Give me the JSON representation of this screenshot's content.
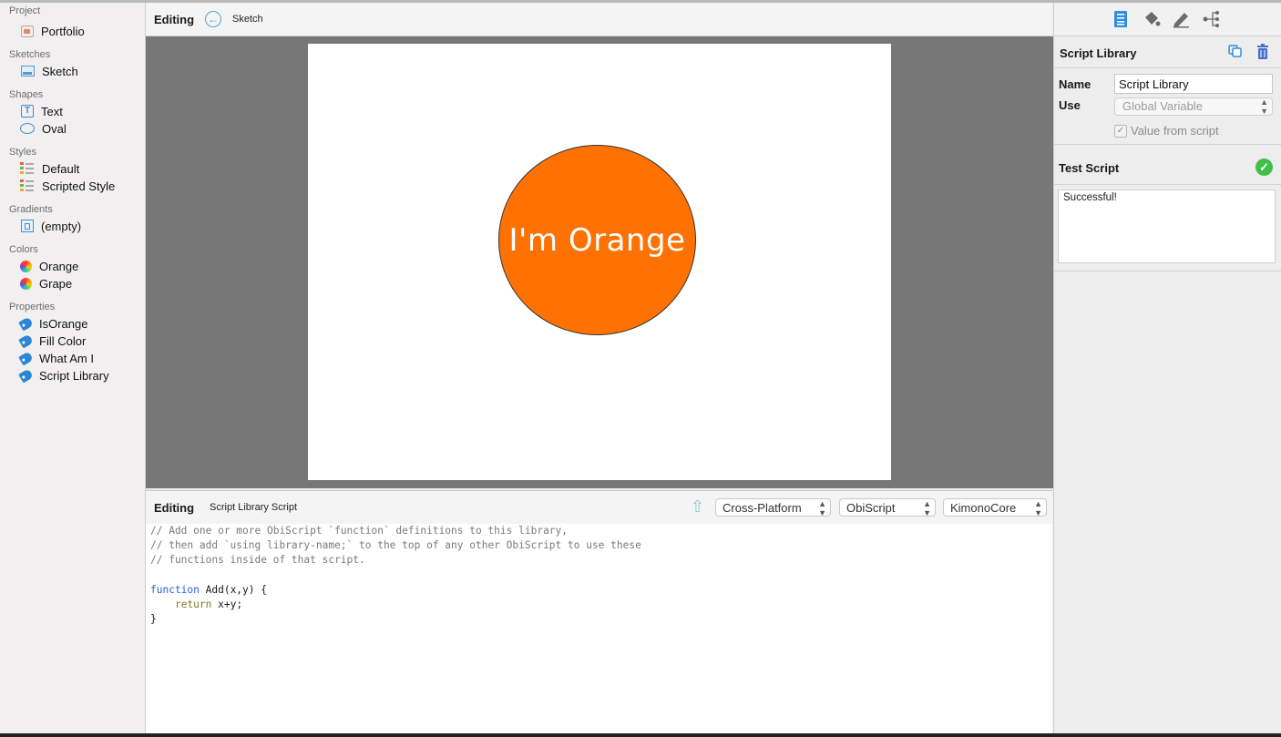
{
  "sidebar": {
    "sections": [
      {
        "title": "Project",
        "items": [
          {
            "label": "Portfolio",
            "icon": "portfolio-icon"
          }
        ]
      },
      {
        "title": "Sketches",
        "items": [
          {
            "label": "Sketch",
            "icon": "sketch-icon"
          }
        ]
      },
      {
        "title": "Shapes",
        "items": [
          {
            "label": "Text",
            "icon": "text-shape-icon"
          },
          {
            "label": "Oval",
            "icon": "oval-shape-icon"
          }
        ]
      },
      {
        "title": "Styles",
        "items": [
          {
            "label": "Default",
            "icon": "style-icon"
          },
          {
            "label": "Scripted Style",
            "icon": "style-icon"
          }
        ]
      },
      {
        "title": "Gradients",
        "items": [
          {
            "label": "(empty)",
            "icon": "gradient-icon"
          }
        ]
      },
      {
        "title": "Colors",
        "items": [
          {
            "label": "Orange",
            "icon": "color-wheel-icon"
          },
          {
            "label": "Grape",
            "icon": "color-wheel-icon"
          }
        ]
      },
      {
        "title": "Properties",
        "items": [
          {
            "label": "IsOrange",
            "icon": "tag-icon"
          },
          {
            "label": "Fill Color",
            "icon": "tag-icon"
          },
          {
            "label": "What Am I",
            "icon": "tag-icon"
          },
          {
            "label": "Script Library",
            "icon": "tag-icon"
          }
        ]
      }
    ]
  },
  "canvas_header": {
    "editing": "Editing",
    "back_icon": "back-arrow-icon",
    "crumb": "Sketch"
  },
  "canvas": {
    "circle_text": "I'm Orange",
    "circle_color": "#ff7100"
  },
  "script_header": {
    "editing": "Editing",
    "title": "Script Library Script",
    "upload_icon": "upload-arrow-icon",
    "platform": "Cross-Platform",
    "language": "ObiScript",
    "framework": "KimonoCore"
  },
  "code": {
    "lines": [
      "// Add one or more ObiScript `function` definitions to this library,",
      "// then add `using library-name;` to the top of any other ObiScript to use these",
      "// functions inside of that script.",
      "",
      "function Add(x,y) {",
      "    return x+y;",
      "}"
    ]
  },
  "inspector": {
    "toolbar_icons": [
      "list-icon",
      "paint-bucket-icon",
      "pen-icon",
      "tree-icon"
    ],
    "title": "Script Library",
    "name_label": "Name",
    "name_value": "Script Library",
    "use_label": "Use",
    "use_value": "Global Variable",
    "value_from_script": "Value from script",
    "test_title": "Test Script",
    "test_result": "Successful!",
    "accent": "#2c86d5"
  }
}
